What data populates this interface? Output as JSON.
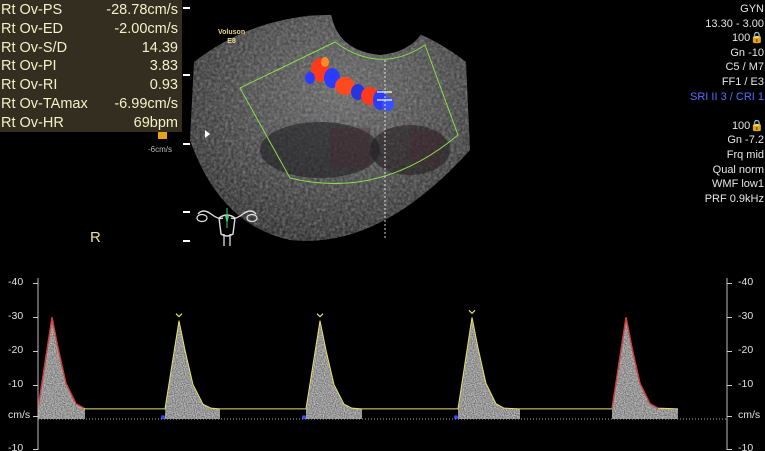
{
  "measurements": [
    {
      "label": "Rt Ov-PS",
      "value": "-28.78cm/s"
    },
    {
      "label": "Rt Ov-ED",
      "value": "-2.00cm/s"
    },
    {
      "label": "Rt Ov-S/D",
      "value": "14.39"
    },
    {
      "label": "Rt Ov-PI",
      "value": "3.83"
    },
    {
      "label": "Rt Ov-RI",
      "value": "0.93"
    },
    {
      "label": "Rt Ov-TAmax",
      "value": "-6.99cm/s"
    },
    {
      "label": "Rt Ov-HR",
      "value": "69bpm"
    }
  ],
  "color_scale_label": "-6cm/s",
  "probe": {
    "brand": "Voluson",
    "model": "E8"
  },
  "orientation": "R",
  "params": [
    {
      "text": "GYN",
      "style": "normal"
    },
    {
      "text": "13.30 - 3.00",
      "style": "normal"
    },
    {
      "text": "100🔒",
      "style": "normal"
    },
    {
      "text": "Gn -10",
      "style": "normal"
    },
    {
      "text": "C5 / M7",
      "style": "normal"
    },
    {
      "text": "FF1 / E3",
      "style": "normal"
    },
    {
      "text": "SRI II 3 / CRI 1",
      "style": "blue"
    },
    {
      "text": "",
      "style": "gap"
    },
    {
      "text": "100🔒",
      "style": "normal"
    },
    {
      "text": "Gn -7.2",
      "style": "normal"
    },
    {
      "text": "Frq mid",
      "style": "normal"
    },
    {
      "text": "Qual norm",
      "style": "normal"
    },
    {
      "text": "WMF low1",
      "style": "normal"
    },
    {
      "text": "PRF  0.9kHz",
      "style": "normal"
    }
  ],
  "axis": {
    "ticks": [
      -40,
      -30,
      -20,
      -10
    ],
    "unit": "cm/s",
    "bottom_tick": -10
  },
  "colors": {
    "panel_text": "#f4f0c8",
    "envelope_systolic": "#d23a3a",
    "envelope_trace": "#e8e26a",
    "color_flow_red": "#ff3a1a",
    "color_flow_blue": "#2a3cff",
    "roi_box": "#8bdc4a"
  }
}
